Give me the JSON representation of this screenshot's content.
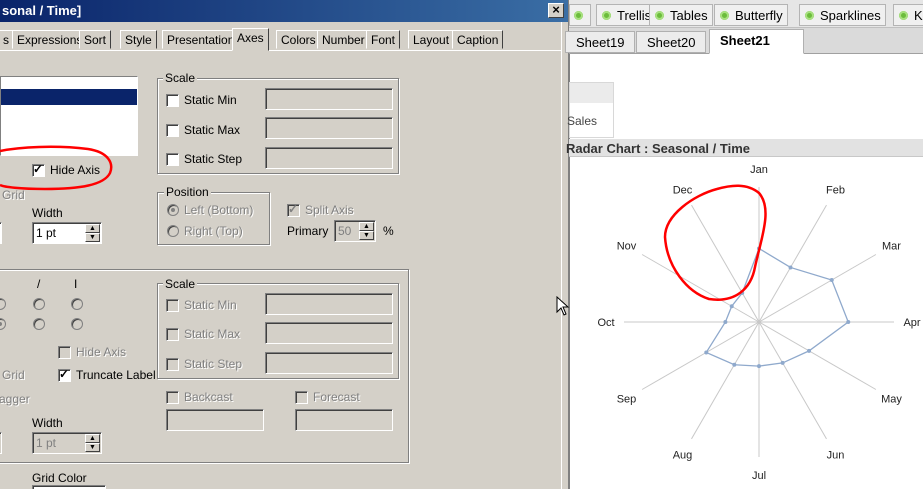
{
  "dialog": {
    "title": "sonal / Time]",
    "tabs": [
      "s",
      "Expressions",
      "Sort",
      "Style",
      "Presentation",
      "Axes",
      "Colors",
      "Number",
      "Font",
      "Layout",
      "Caption"
    ],
    "active_tab": "Axes",
    "upper": {
      "scale_label": "Scale",
      "static_min": "Static Min",
      "static_max": "Static Max",
      "static_step": "Static Step",
      "hide_axis": "Hide Axis",
      "grid_partial": "Grid",
      "width_label": "Width",
      "width_value": "1 pt",
      "position_label": "Position",
      "left_bottom": "Left (Bottom)",
      "right_top": "Right (Top)",
      "split_axis": "Split Axis",
      "primary_label": "Primary",
      "primary_value": "50",
      "percent": "%"
    },
    "lower": {
      "col_slash": "/",
      "col_bar": "I",
      "scale_label": "Scale",
      "static_min": "Static Min",
      "static_max": "Static Max",
      "static_step": "Static Step",
      "hide_axis": "Hide Axis",
      "grid_partial": "Grid",
      "truncate_label": "Truncate Label",
      "stagger_partial": "agger",
      "backcast": "Backcast",
      "forecast": "Forecast",
      "width_label": "Width",
      "width_value": "1 pt",
      "grid_color": "Grid Color"
    }
  },
  "app": {
    "top_tabs": [
      "Trellis",
      "Tables",
      "Butterfly",
      "Sparklines",
      "K"
    ],
    "sheet_tabs": [
      "Sheet19",
      "Sheet20",
      "Sheet21"
    ],
    "active_sheet": "Sheet21",
    "sales_label": "Sales",
    "chart_title": "Radar Chart : Seasonal / Time"
  },
  "chart_data": {
    "type": "radar",
    "title": "Radar Chart : Seasonal / Time",
    "categories": [
      "Jan",
      "Feb",
      "Mar",
      "Apr",
      "May",
      "Jun",
      "Jul",
      "Aug",
      "Sep",
      "Oct",
      "Nov",
      "Dec"
    ],
    "series": [
      {
        "values": [
          0.7,
          0.6,
          0.8,
          0.85,
          0.55,
          0.45,
          0.42,
          0.47,
          0.58,
          0.32,
          0.3,
          0.32
        ]
      }
    ],
    "rmax": 1,
    "grid": false,
    "colors": {
      "series": "#8fa9cc",
      "spoke": "#c8c8c8"
    }
  },
  "colors": {
    "dialog_bg": "#d4d0c8",
    "title_bar": "#0a246a",
    "selection": "#0a246a",
    "annotation_red": "#ff0000",
    "status_green": "#6cbc3c"
  }
}
